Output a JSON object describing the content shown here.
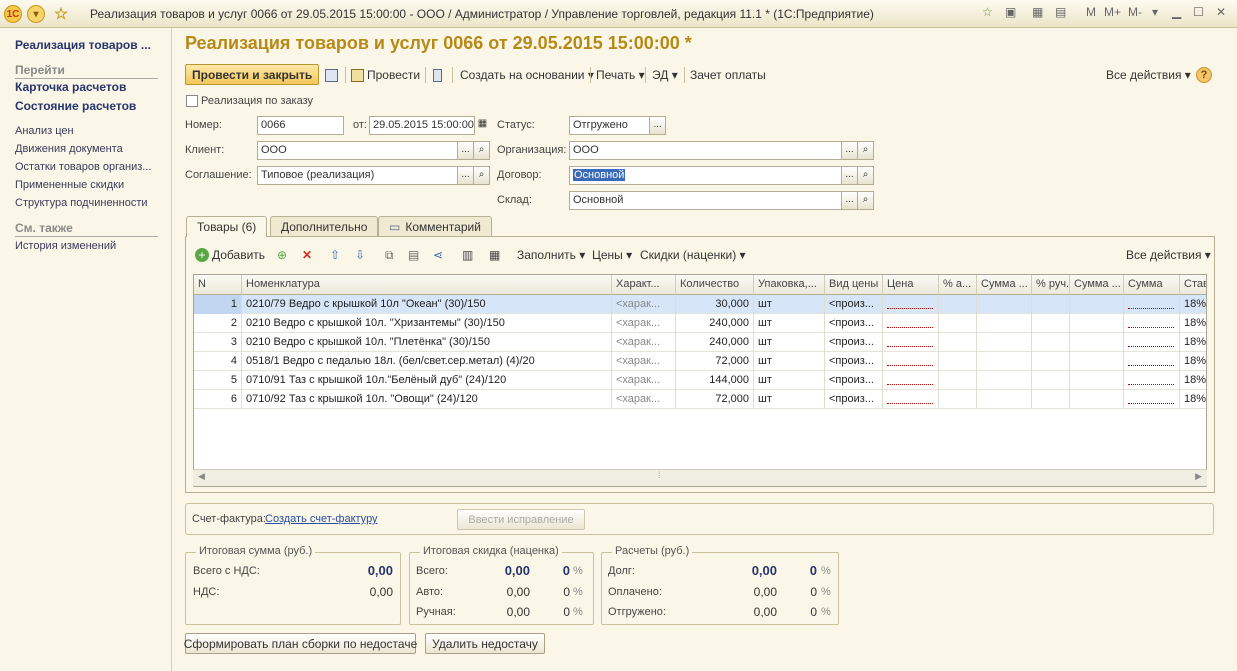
{
  "window": {
    "title": "Реализация товаров и услуг 0066 от 29.05.2015 15:00:00 - ООО / Администратор / Управление торговлей, редакция 11.1  * (1С:Предприятие)",
    "mem_buttons": [
      "M",
      "M+",
      "M-"
    ]
  },
  "sidebar": {
    "doc_title": "Реализация товаров ...",
    "goto_label": "Перейти",
    "goto_items": [
      "Карточка расчетов",
      "Состояние расчетов"
    ],
    "links": [
      "Анализ цен",
      "Движения документа",
      "Остатки товаров организ...",
      "Примененные скидки",
      "Структура подчиненности"
    ],
    "see_also_label": "См. также",
    "see_also_items": [
      "История изменений"
    ]
  },
  "header": {
    "title": "Реализация товаров и услуг 0066 от 29.05.2015 15:00:00 *"
  },
  "toolbar": {
    "post_close": "Провести и закрыть",
    "post": "Провести",
    "create_based": "Создать на основании",
    "print": "Печать",
    "ed": "ЭД",
    "payment_offset": "Зачет оплаты",
    "all_actions": "Все действия"
  },
  "form": {
    "by_order_label": "Реализация по заказу",
    "number_label": "Номер:",
    "number_value": "0066",
    "from_label": "от:",
    "date_value": "29.05.2015 15:00:00",
    "status_label": "Статус:",
    "status_value": "Отгружено",
    "client_label": "Клиент:",
    "client_value": "ООО",
    "org_label": "Организация:",
    "org_value": "ООО",
    "agreement_label": "Соглашение:",
    "agreement_value": "Типовое (реализация)",
    "contract_label": "Договор:",
    "contract_value": "Основной",
    "warehouse_label": "Склад:",
    "warehouse_value": "Основной"
  },
  "tabs": [
    "Товары (6)",
    "Дополнительно",
    "Комментарий"
  ],
  "table_toolbar": {
    "add": "Добавить",
    "fill": "Заполнить",
    "prices": "Цены",
    "discounts": "Скидки (наценки)",
    "all_actions": "Все действия"
  },
  "table": {
    "columns": [
      "N",
      "Номенклатура",
      "Характ...",
      "Количество",
      "Упаковка,...",
      "Вид цены",
      "Цена",
      "% а...",
      "Сумма ...",
      "% руч.",
      "Сумма ...",
      "Сумма",
      "Став"
    ],
    "rows": [
      {
        "n": "1",
        "name": "0210/79 Ведро с крышкой 10л \"Океан\" (30)/150",
        "char": "<харак...",
        "qty": "30,000",
        "pack": "шт",
        "price_type": "<произ...",
        "rate": "18%"
      },
      {
        "n": "2",
        "name": "0210 Ведро с крышкой 10л. \"Хризантемы\" (30)/150",
        "char": "<харак...",
        "qty": "240,000",
        "pack": "шт",
        "price_type": "<произ...",
        "rate": "18%"
      },
      {
        "n": "3",
        "name": "0210 Ведро с крышкой 10л. \"Плетёнка\" (30)/150",
        "char": "<харак...",
        "qty": "240,000",
        "pack": "шт",
        "price_type": "<произ...",
        "rate": "18%"
      },
      {
        "n": "4",
        "name": "0518/1 Ведро с педалью 18л. (бел/свет.сер.метал) (4)/20",
        "char": "<харак...",
        "qty": "72,000",
        "pack": "шт",
        "price_type": "<произ...",
        "rate": "18%"
      },
      {
        "n": "5",
        "name": "0710/91 Таз с крышкой 10л.\"Белёный дуб\" (24)/120",
        "char": "<харак...",
        "qty": "144,000",
        "pack": "шт",
        "price_type": "<произ...",
        "rate": "18%"
      },
      {
        "n": "6",
        "name": "0710/92 Таз с крышкой 10л. \"Овощи\" (24)/120",
        "char": "<харак...",
        "qty": "72,000",
        "pack": "шт",
        "price_type": "<произ...",
        "rate": "18%"
      }
    ]
  },
  "invoice": {
    "label": "Счет-фактура:",
    "create_link": "Создать счет-фактуру",
    "correction_button": "Ввести исправление"
  },
  "totals": {
    "title": "Итоговая сумма (руб.)",
    "with_vat_label": "Всего с НДС:",
    "with_vat_value": "0,00",
    "vat_label": "НДС:",
    "vat_value": "0,00"
  },
  "discount": {
    "title": "Итоговая скидка (наценка)",
    "total_label": "Всего:",
    "total_value": "0,00",
    "total_pct": "0",
    "auto_label": "Авто:",
    "auto_value": "0,00",
    "auto_pct": "0",
    "manual_label": "Ручная:",
    "manual_value": "0,00",
    "manual_pct": "0",
    "pct_sign": "%"
  },
  "payments": {
    "title": "Расчеты (руб.)",
    "debt_label": "Долг:",
    "debt_value": "0,00",
    "debt_pct": "0",
    "paid_label": "Оплачено:",
    "paid_value": "0,00",
    "paid_pct": "0",
    "shipped_label": "Отгружено:",
    "shipped_value": "0,00",
    "shipped_pct": "0",
    "pct_sign": "%"
  },
  "bottom_buttons": {
    "build_plan": "Сформировать план сборки по недостаче",
    "delete_shortage": "Удалить недостачу"
  }
}
